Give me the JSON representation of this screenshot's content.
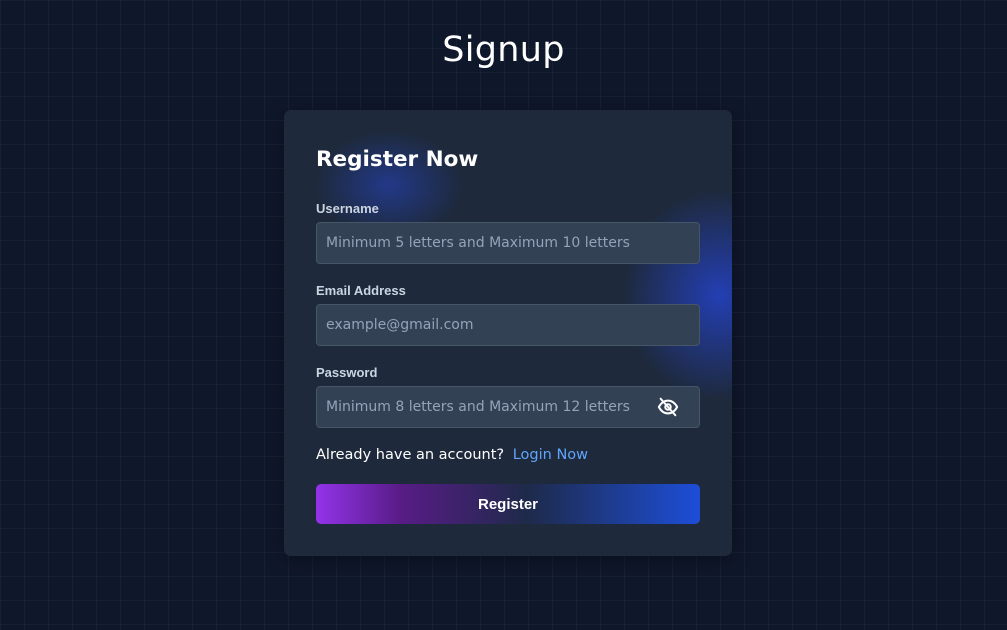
{
  "page": {
    "title": "Signup"
  },
  "form": {
    "heading": "Register Now",
    "fields": [
      {
        "label": "Username",
        "value": "",
        "placeholder": "Minimum 5 letters and Maximum 10 letters",
        "type": "text"
      },
      {
        "label": "Email Address",
        "value": "",
        "placeholder": "example@gmail.com",
        "type": "email"
      },
      {
        "label": "Password",
        "value": "",
        "placeholder": "Minimum 8 letters and Maximum 12 letters",
        "type": "password",
        "toggle_icon": "eye-slash-icon"
      }
    ],
    "account_prompt": "Already have an account?",
    "login_link": "Login Now",
    "submit_label": "Register"
  },
  "colors": {
    "background": "#0f172a",
    "card": "#1e293b",
    "input": "#334155",
    "link": "#60a5fa",
    "button_gradient_start": "#9333ea",
    "button_gradient_end": "#1d4ed8"
  }
}
